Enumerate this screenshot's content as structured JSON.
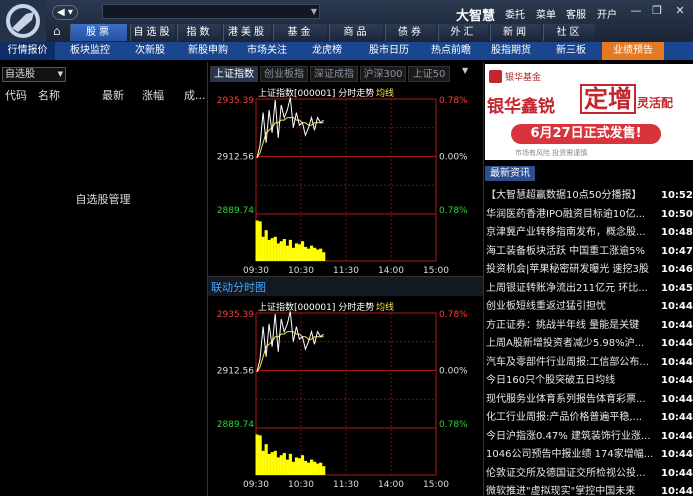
{
  "app": {
    "brand": "大智慧",
    "links": [
      "委托",
      "菜单",
      "客服",
      "开户"
    ]
  },
  "main_tabs": [
    {
      "label": "股票",
      "active": true
    },
    {
      "label": "自选股"
    },
    {
      "label": "指数"
    },
    {
      "label": "港美股"
    },
    {
      "label": "基金"
    },
    {
      "label": "商品"
    },
    {
      "label": "债券"
    },
    {
      "label": "外汇"
    },
    {
      "label": "新闻"
    },
    {
      "label": "社区"
    }
  ],
  "sub_tabs": [
    {
      "label": "行情报价",
      "active": true
    },
    {
      "label": "板块监控"
    },
    {
      "label": "次新股"
    },
    {
      "label": "新股申购"
    },
    {
      "label": "市场关注"
    },
    {
      "label": "龙虎榜"
    },
    {
      "label": "股市日历"
    },
    {
      "label": "热点前瞻"
    },
    {
      "label": "股指期货"
    },
    {
      "label": "新三板"
    },
    {
      "label": "业绩预告",
      "highlight": true
    }
  ],
  "watchlist": {
    "selected": "自选股",
    "columns": [
      "代码",
      "名称",
      "最新",
      "涨幅",
      "成..."
    ],
    "empty_message": "自选股管理"
  },
  "chart_tabs": [
    {
      "label": "上证指数",
      "active": true
    },
    {
      "label": "创业板指"
    },
    {
      "label": "深证成指"
    },
    {
      "label": "沪深300"
    },
    {
      "label": "上证50"
    }
  ],
  "linked_label": "联动分时图",
  "chart_data": [
    {
      "type": "line",
      "title": "上证指数[000001] 分时走势",
      "legend": [
        "均线"
      ],
      "y_labels_left": [
        "2935.39",
        "2912.56",
        "2889.74"
      ],
      "y_labels_right": [
        "0.78%",
        "0.00%",
        "0.78%"
      ],
      "x_labels": [
        "09:30",
        "10:30",
        "11:30",
        "14:00",
        "15:00"
      ],
      "series": [
        {
          "name": "均线",
          "values": [
            2912,
            2914,
            2918,
            2922,
            2923,
            2924,
            2926,
            2926,
            2927,
            2927,
            2928,
            2928,
            2928,
            2927,
            2927,
            2926,
            2926,
            2925,
            2925,
            2926,
            2926,
            2926,
            2926
          ]
        },
        {
          "values": [
            2912,
            2917,
            2930,
            2918,
            2931,
            2922,
            2935,
            2920,
            2933,
            2928,
            2931,
            2936,
            2924,
            2930,
            2925,
            2926,
            2921,
            2924,
            2928,
            2923,
            2928,
            2926,
            2927
          ]
        }
      ],
      "volume": [
        92,
        90,
        55,
        70,
        48,
        52,
        55,
        40,
        45,
        50,
        35,
        48,
        30,
        40,
        38,
        45,
        32,
        28,
        35,
        30,
        26,
        28,
        20
      ]
    },
    {
      "type": "line",
      "title": "上证指数[000001] 分时走势",
      "legend": [
        "均线"
      ],
      "y_labels_left": [
        "2935.39",
        "2912.56",
        "2889.74"
      ],
      "y_labels_right": [
        "0.78%",
        "0.00%",
        "0.78%"
      ],
      "x_labels": [
        "09:30",
        "10:30",
        "11:30",
        "14:00",
        "15:00"
      ],
      "series": [
        {
          "name": "均线",
          "values": [
            2912,
            2914,
            2918,
            2922,
            2923,
            2924,
            2926,
            2926,
            2927,
            2927,
            2928,
            2928,
            2928,
            2927,
            2927,
            2926,
            2926,
            2925,
            2925,
            2926,
            2926,
            2926,
            2926
          ]
        },
        {
          "values": [
            2912,
            2917,
            2930,
            2918,
            2931,
            2922,
            2935,
            2920,
            2933,
            2928,
            2931,
            2936,
            2924,
            2930,
            2925,
            2926,
            2921,
            2924,
            2928,
            2923,
            2928,
            2926,
            2927
          ]
        }
      ],
      "volume": [
        92,
        90,
        55,
        70,
        48,
        52,
        55,
        40,
        45,
        50,
        35,
        48,
        30,
        40,
        38,
        45,
        32,
        28,
        35,
        30,
        26,
        28,
        20
      ]
    }
  ],
  "ad": {
    "brand": "银华基金",
    "title": "银华鑫锐",
    "title2": "定增",
    "title3": "灵活配",
    "date_text": "6月27日正式发售!",
    "sub": "市场有风险  投资需谨慎"
  },
  "news": {
    "tab_label": "最新资讯",
    "items": [
      {
        "title": "【大智慧超赢数据10点50分播报】",
        "time": "10:52"
      },
      {
        "title": "华润医药香港IPO融资目标逾10亿...",
        "time": "10:50"
      },
      {
        "title": "京津冀产业转移指南发布，概念股...",
        "time": "10:48"
      },
      {
        "title": "海工装备板块活跃 中国重工涨逾5%",
        "time": "10:47"
      },
      {
        "title": "投资机会|苹果秘密研发曝光 速挖3股",
        "time": "10:46"
      },
      {
        "title": "上周银证转账净流出211亿元 环比...",
        "time": "10:45"
      },
      {
        "title": "创业板短线重返过猛引担忧",
        "time": "10:44"
      },
      {
        "title": "方正证券：挑战半年线 量能是关键",
        "time": "10:44"
      },
      {
        "title": "上周A股新增投资者减少5.98%沪...",
        "time": "10:44"
      },
      {
        "title": "汽车及零部件行业周报:工信部公布...",
        "time": "10:44"
      },
      {
        "title": "今日160只个股突破五日均线",
        "time": "10:44"
      },
      {
        "title": "现代服务业体育系列报告体育彩票...",
        "time": "10:44"
      },
      {
        "title": "化工行业周报:产品价格普遍平稳,...",
        "time": "10:44"
      },
      {
        "title": "今日沪指涨0.47% 建筑装饰行业涨...",
        "time": "10:44"
      },
      {
        "title": "1046公司预告中报业绩 174家增幅...",
        "time": "10:44"
      },
      {
        "title": "伦敦证交所及德国证交所检视公投...",
        "time": "10:44"
      },
      {
        "title": "微软推进\"虚拟现实\"掌控中国未来",
        "time": "10:44"
      }
    ]
  },
  "colors": {
    "up": "#ff3b3b",
    "down": "#2bd43a",
    "price_line": "#ffffff",
    "avg_line": "#f5e64a",
    "volume": "#ffff00",
    "accent": "#1a4690"
  }
}
